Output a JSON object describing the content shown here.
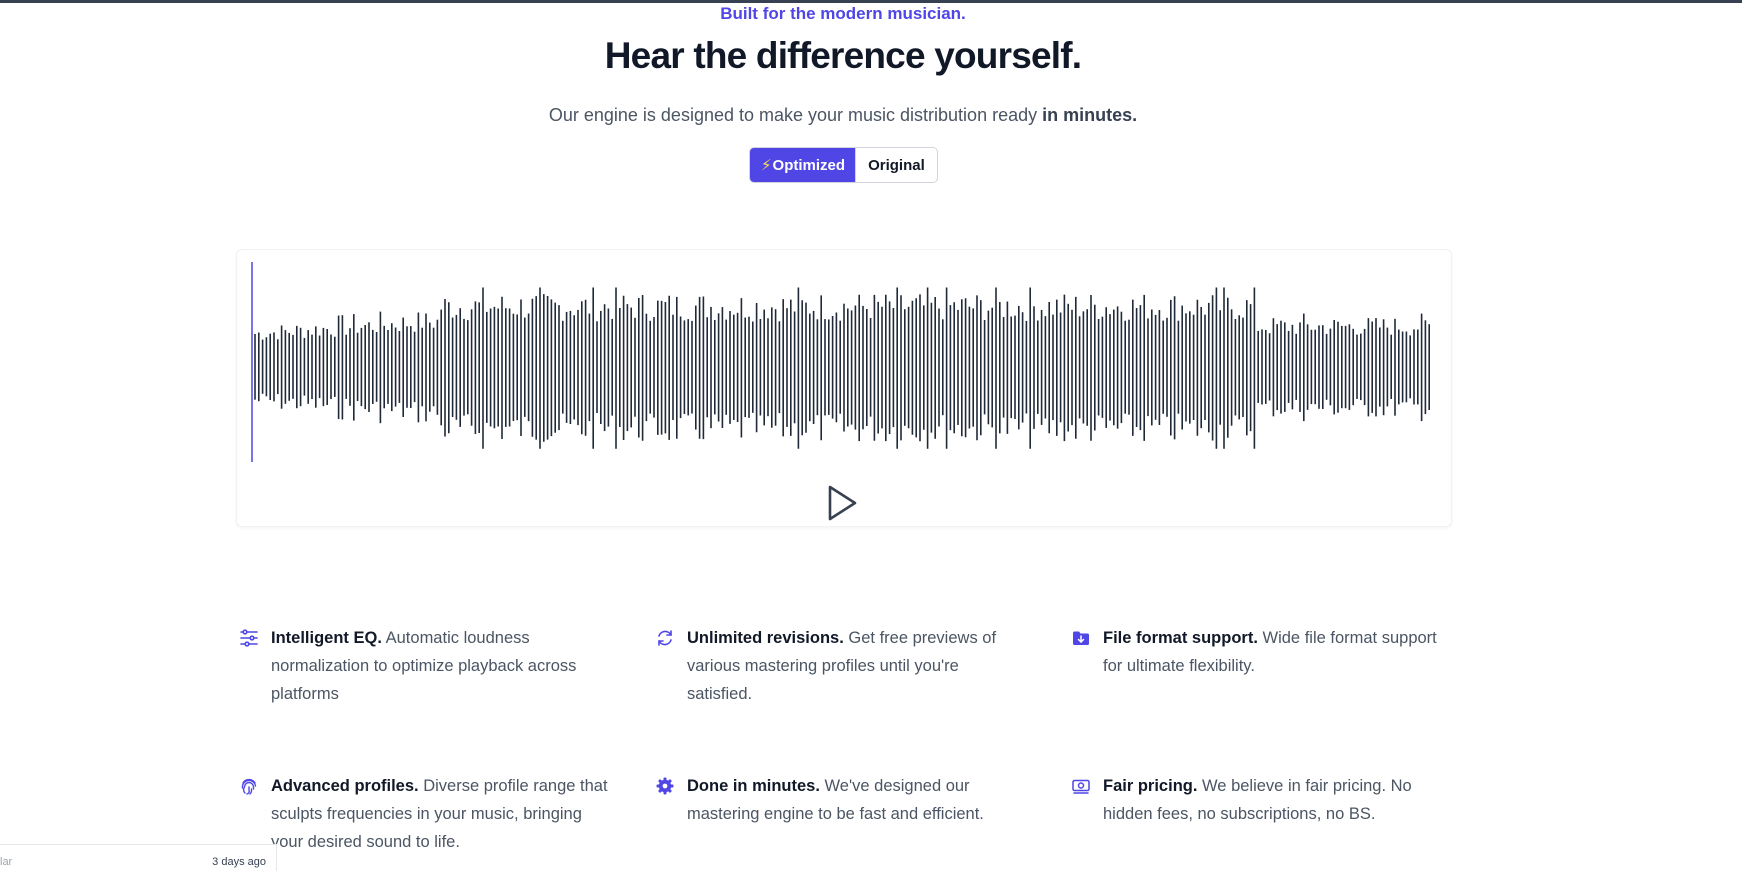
{
  "hero": {
    "eyebrow": "Built for the modern musician.",
    "headline": "Hear the difference yourself.",
    "subhead_prefix": "Our engine is designed to make your music distribution ready ",
    "subhead_bold": "in minutes."
  },
  "toggle": {
    "options": [
      {
        "label": "Optimized",
        "icon": "lightning-bolt-icon",
        "active": true
      },
      {
        "label": "Original",
        "active": false
      }
    ],
    "bolt_glyph": "⚡"
  },
  "player": {
    "playhead_progress": 0.0,
    "play_icon": "play-icon"
  },
  "colors": {
    "accent": "#4f46e5",
    "wave": "#1f2937",
    "text_primary": "#111827",
    "text_secondary": "#4b5563"
  },
  "features": [
    {
      "icon": "sliders-icon",
      "title": "Intelligent EQ.",
      "text": "Automatic loudness normalization to optimize playback across platforms"
    },
    {
      "icon": "refresh-icon",
      "title": "Unlimited revisions.",
      "text": "Get free previews of various mastering profiles until you're satisfied."
    },
    {
      "icon": "folder-download-icon",
      "title": "File format support.",
      "text": "Wide file format support for ultimate flexibility."
    },
    {
      "icon": "fingerprint-icon",
      "title": "Advanced profiles.",
      "text": "Diverse profile range that sculpts frequencies in your music, bringing your desired sound to life."
    },
    {
      "icon": "gear-icon",
      "title": "Done in minutes.",
      "text": "We've designed our mastering engine to be fast and efficient."
    },
    {
      "icon": "banknote-icon",
      "title": "Fair pricing.",
      "text": "We believe in fair pricing. No hidden fees, no subscriptions, no BS."
    }
  ],
  "bottom_tab": {
    "left_text": "lar",
    "right_text": "3 days ago"
  }
}
